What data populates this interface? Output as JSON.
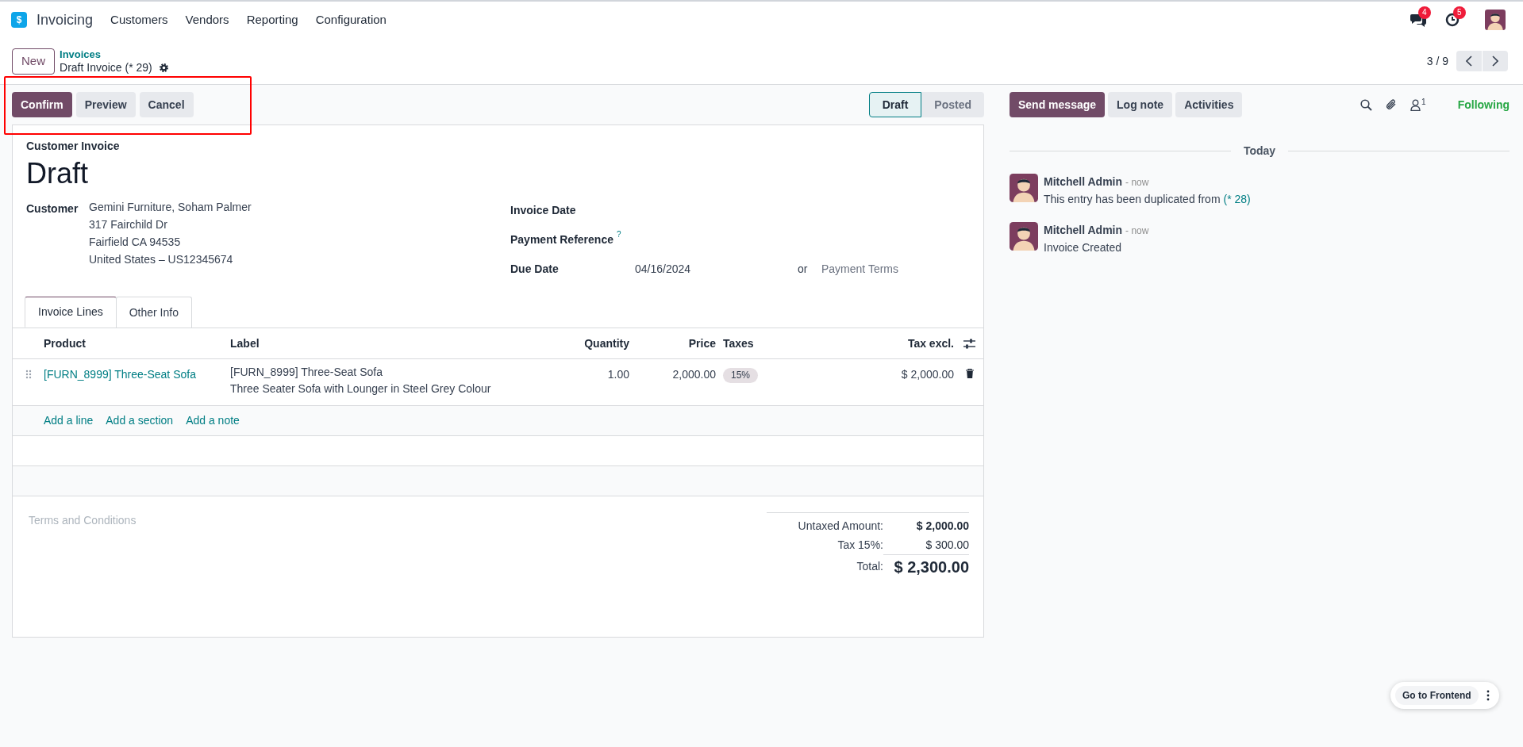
{
  "navbar": {
    "app_icon_glyph": "$",
    "app_name": "Invoicing",
    "menus": [
      "Customers",
      "Vendors",
      "Reporting",
      "Configuration"
    ],
    "messages_count": "4",
    "activities_count": "5"
  },
  "control_panel": {
    "new_button": "New",
    "breadcrumb_parent": "Invoices",
    "breadcrumb_current": "Draft Invoice (* 29)",
    "pager": "3 / 9"
  },
  "actions": [
    "Confirm",
    "Preview",
    "Cancel"
  ],
  "statusbar": [
    {
      "label": "Draft",
      "selected": true
    },
    {
      "label": "Posted",
      "selected": false
    }
  ],
  "form": {
    "type_label": "Customer Invoice",
    "title": "Draft",
    "customer_label": "Customer",
    "customer_address": [
      "Gemini Furniture, Soham Palmer",
      "317 Fairchild Dr",
      "Fairfield CA 94535",
      "United States – US12345674"
    ],
    "right_fields": [
      {
        "label": "Invoice Date"
      },
      {
        "label": "Payment Reference",
        "help": "?"
      },
      {
        "label": "Due Date",
        "value": "04/16/2024",
        "or": "or",
        "placeholder": "Payment Terms"
      }
    ]
  },
  "tabs": [
    {
      "label": "Invoice Lines",
      "selected": true
    },
    {
      "label": "Other Info",
      "selected": false
    }
  ],
  "table": {
    "columns": [
      "Product",
      "Label",
      "Quantity",
      "Price",
      "Taxes",
      "Tax excl."
    ],
    "rows": [
      {
        "product": "[FURN_8999] Three-Seat Sofa",
        "label": [
          "[FURN_8999] Three-Seat Sofa",
          "Three Seater Sofa with Lounger in Steel Grey Colour"
        ],
        "quantity": "1.00",
        "price": "2,000.00",
        "taxes": "15%",
        "tax_excl": "$ 2,000.00"
      }
    ],
    "add_links": [
      "Add a line",
      "Add a section",
      "Add a note"
    ]
  },
  "terms_placeholder": "Terms and Conditions",
  "totals": [
    {
      "kind": "subtotal",
      "label": "Untaxed Amount:",
      "value": "$ 2,000.00"
    },
    {
      "kind": "tax",
      "label": "Tax 15%:",
      "value": "$ 300.00"
    },
    {
      "kind": "total",
      "label": "Total:",
      "value": "$ 2,300.00"
    }
  ],
  "chatter": {
    "buttons": [
      {
        "label": "Send message",
        "selected": true
      },
      {
        "label": "Log note",
        "selected": false
      },
      {
        "label": "Activities",
        "selected": false
      }
    ],
    "followers_count": "1",
    "following": "Following",
    "date_separator": "Today",
    "messages": [
      {
        "author": "Mitchell Admin",
        "time": "- now",
        "body": "This entry has been duplicated from",
        "link": "(* 28)"
      },
      {
        "author": "Mitchell Admin",
        "time": "- now",
        "body": "Invoice Created"
      }
    ]
  },
  "frontend_button": "Go to Frontend"
}
